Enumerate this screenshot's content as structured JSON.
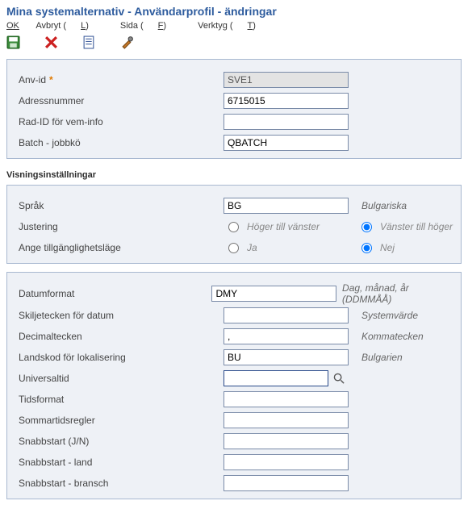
{
  "title": "Mina systemalternativ - Användarprofil - ändringar",
  "menu": {
    "ok": "OK",
    "cancel_pre": "Avbryt (",
    "cancel_u": "L",
    "cancel_post": ")",
    "page_pre": "Sida (",
    "page_u": "F",
    "page_post": ")",
    "tools_pre": "Verktyg (",
    "tools_u": "T",
    "tools_post": ")"
  },
  "fields": {
    "user_id": {
      "label": "Anv-id",
      "value": "SVE1"
    },
    "address_no": {
      "label": "Adressnummer",
      "value": "6715015"
    },
    "row_id": {
      "label": "Rad-ID för vem-info",
      "value": ""
    },
    "batch_queue": {
      "label": "Batch - jobbkö",
      "value": "QBATCH"
    }
  },
  "section2_title": "Visningsinställningar",
  "display": {
    "language": {
      "label": "Språk",
      "value": "BG",
      "desc": "Bulgariska"
    },
    "justification": {
      "label": "Justering",
      "opt1": "Höger till vänster",
      "opt2": "Vänster till höger"
    },
    "accessibility": {
      "label": "Ange tillgänglighetsläge",
      "opt1": "Ja",
      "opt2": "Nej"
    },
    "date_format": {
      "label": "Datumformat",
      "value": "DMY",
      "desc": "Dag, månad, år (DDMMÅÅ)"
    },
    "date_sep": {
      "label": "Skiljetecken för datum",
      "value": "",
      "desc": "Systemvärde"
    },
    "decimal": {
      "label": "Decimaltecken",
      "value": ",",
      "desc": "Kommatecken"
    },
    "country": {
      "label": "Landskod för lokalisering",
      "value": "BU",
      "desc": "Bulgarien"
    },
    "universal_time": {
      "label": "Universaltid",
      "value": ""
    },
    "time_format": {
      "label": "Tidsformat",
      "value": ""
    },
    "dst": {
      "label": "Sommartidsregler",
      "value": ""
    },
    "fastpath": {
      "label": "Snabbstart (J/N)",
      "value": ""
    },
    "fastpath_country": {
      "label": "Snabbstart - land",
      "value": ""
    },
    "fastpath_industry": {
      "label": "Snabbstart - bransch",
      "value": ""
    }
  }
}
